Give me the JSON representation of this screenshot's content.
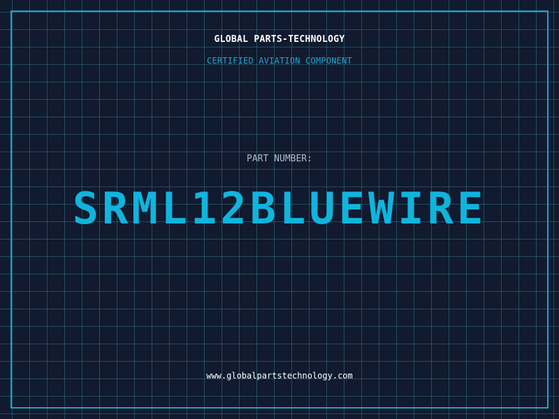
{
  "header": {
    "company": "GLOBAL PARTS-TECHNOLOGY",
    "tagline": "CERTIFIED AVIATION COMPONENT"
  },
  "part": {
    "label": "PART NUMBER:",
    "number": "SRML12BLUEWIRE"
  },
  "footer": {
    "website": "www.globalpartstechnology.com"
  },
  "colors": {
    "background": "#111a2e",
    "grid": "#3c96af",
    "accent": "#10b4dc",
    "frame": "#1fa2c8",
    "label": "#b3bccb",
    "text": "#ffffff"
  }
}
